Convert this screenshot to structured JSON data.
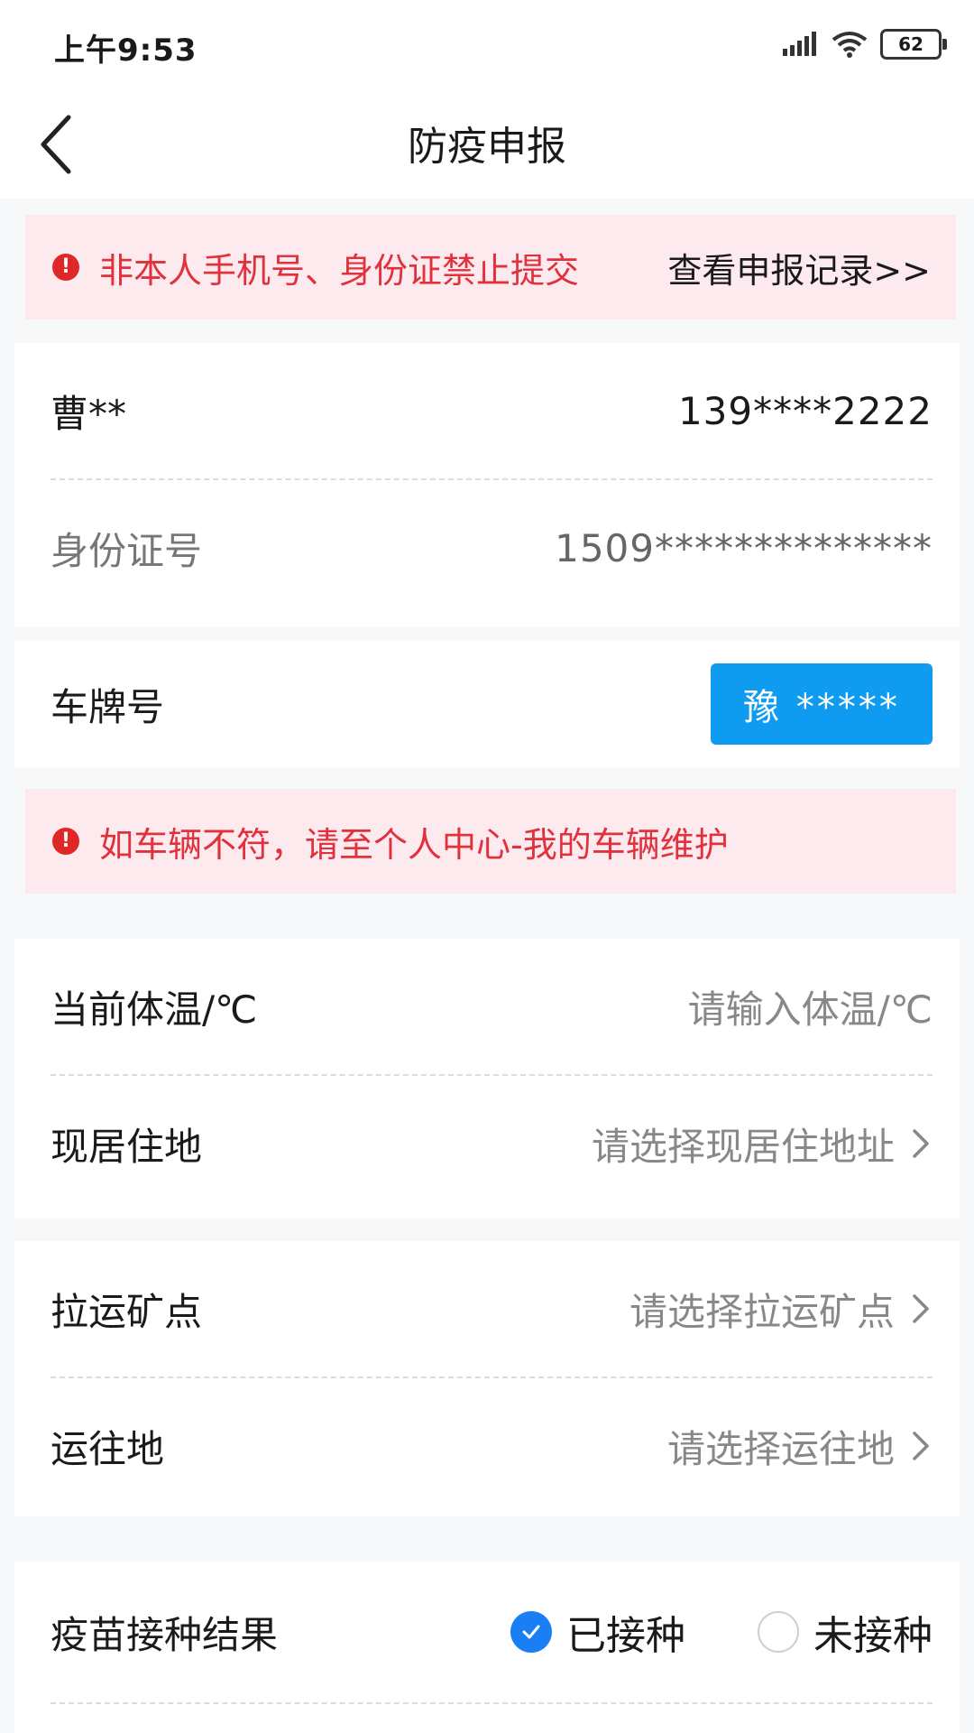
{
  "status_bar": {
    "time": "上午9:53",
    "battery": "62",
    "icons": [
      "signal-icon",
      "wifi-icon",
      "battery-icon"
    ]
  },
  "header": {
    "title": "防疫申报",
    "back_icon": "back-arrow-icon"
  },
  "alert_top": {
    "icon": "alert-circle-icon",
    "text": "非本人手机号、身份证禁止提交",
    "link": "查看申报记录>>"
  },
  "identity": {
    "name": "曹**",
    "phone": "139****2222",
    "id_label": "身份证号",
    "id_value": "1509**************"
  },
  "vehicle": {
    "label": "车牌号",
    "plate": "豫 *****"
  },
  "alert_vehicle": {
    "icon": "alert-circle-icon",
    "text": "如车辆不符，请至个人中心-我的车辆维护"
  },
  "form": {
    "temperature": {
      "label": "当前体温/℃",
      "placeholder": "请输入体温/℃"
    },
    "residence": {
      "label": "现居住地",
      "placeholder": "请选择现居住地址"
    },
    "mine_point": {
      "label": "拉运矿点",
      "placeholder": "请选择拉运矿点"
    },
    "destination": {
      "label": "运往地",
      "placeholder": "请选择运往地"
    }
  },
  "vaccination": {
    "label": "疫苗接种结果",
    "options": [
      {
        "label": "已接种",
        "checked": true
      },
      {
        "label": "未接种",
        "checked": false
      }
    ]
  },
  "colors": {
    "alert_bg": "#fdeaee",
    "alert_text": "#e0313c",
    "plate_bg": "#0f9bf0",
    "radio_checked": "#1a7ef5"
  }
}
